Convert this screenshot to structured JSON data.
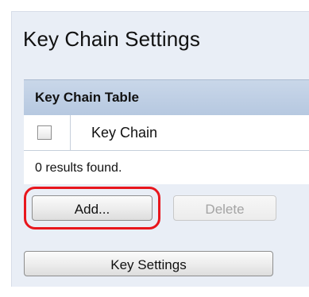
{
  "page": {
    "title": "Key Chain Settings"
  },
  "table": {
    "header": "Key Chain Table",
    "column_label": "Key Chain",
    "results_text": "0 results found."
  },
  "buttons": {
    "add_label": "Add...",
    "delete_label": "Delete",
    "key_settings_label": "Key Settings"
  },
  "colors": {
    "highlight": "#e8161d",
    "header_bg": "#c9d7e9",
    "panel_bg": "#e9eef6"
  }
}
